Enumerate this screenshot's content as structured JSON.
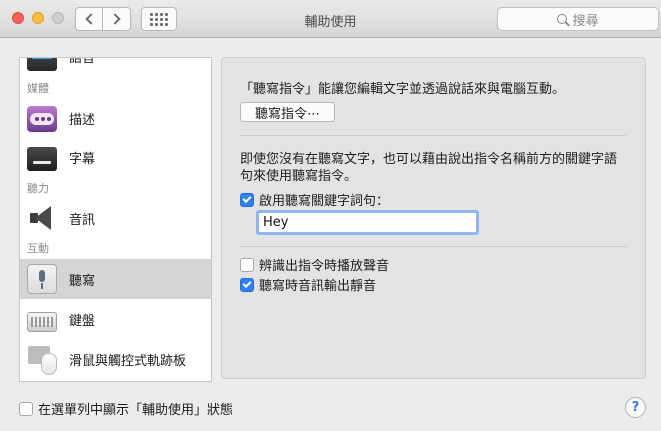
{
  "window": {
    "title": "輔助使用"
  },
  "search": {
    "placeholder": "搜尋"
  },
  "sidebar": {
    "partial_item": {
      "label": "語音"
    },
    "sections": {
      "media": "媒體",
      "hearing": "聽力",
      "interaction": "互動"
    },
    "items": [
      {
        "label": "描述",
        "icon": "description-icon"
      },
      {
        "label": "字幕",
        "icon": "subtitles-icon"
      },
      {
        "label": "音訊",
        "icon": "speaker-icon"
      },
      {
        "label": "聽寫",
        "icon": "microphone-icon",
        "selected": true
      },
      {
        "label": "鍵盤",
        "icon": "keyboard-icon"
      },
      {
        "label": "滑鼠與觸控式軌跡板",
        "icon": "mouse-trackpad-icon"
      }
    ]
  },
  "main": {
    "intro_text": "「聽寫指令」能讓您編輯文字並透過說話來與電腦互動。",
    "commands_button": "聽寫指令⋯",
    "keyword_desc_line1": "即使您沒有在聽寫文字，也可以藉由說出指令名稱前方的關鍵字語",
    "keyword_desc_line2": "句來使用聽寫指令。",
    "enable_keyword_label": "啟用聽寫關鍵字詞句：",
    "enable_keyword_checked": true,
    "keyword_value": "Hey",
    "play_sound_label": "辨識出指令時播放聲音",
    "play_sound_checked": false,
    "mute_audio_label": "聽寫時音訊輸出靜音",
    "mute_audio_checked": true
  },
  "footer": {
    "menu_bar_label": "在選單列中顯示「輔助使用」狀態",
    "menu_bar_checked": false,
    "help": "?"
  },
  "colors": {
    "accent": "#2f7ff5",
    "focus_ring": "#8fb6ee",
    "selected_row": "#d5d5d5"
  }
}
